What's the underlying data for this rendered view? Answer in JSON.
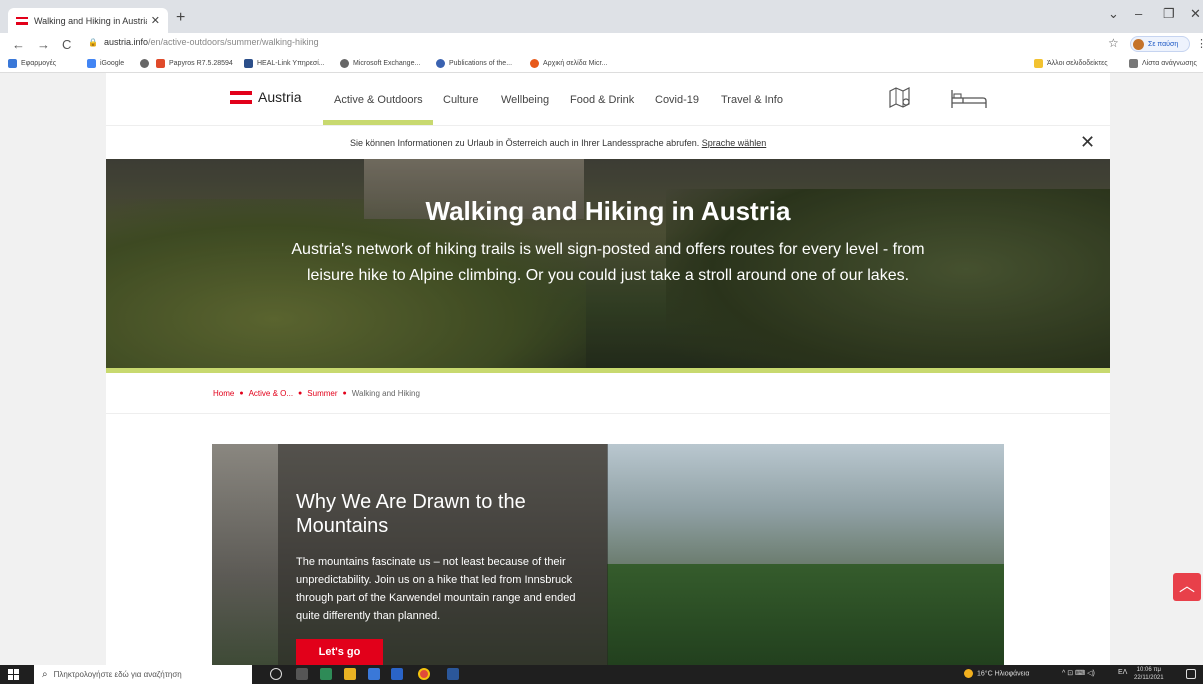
{
  "browser": {
    "tab_title": "Walking and Hiking in Austria -",
    "tab_close": "✕",
    "new_tab": "+",
    "url_host": "austria.info",
    "url_path": "/en/active-outdoors/summer/walking-hiking",
    "profile_label": "Σε παύση",
    "bookmarks": [
      "Εφαρμογές",
      "iGoogle",
      "",
      "Papyros R7.5.28594",
      "HEAL-Link Υπηρεσί...",
      "Microsoft Exchange...",
      "Publications of the...",
      "Αρχική σελίδα Micr..."
    ],
    "bookmarks_right": [
      "Άλλοι σελιδοδείκτες",
      "Λίστα ανάγνωσης"
    ]
  },
  "site": {
    "logo": "Austria",
    "nav": [
      "Active & Outdoors",
      "Culture",
      "Wellbeing",
      "Food & Drink",
      "Covid-19",
      "Travel & Info"
    ],
    "lang_notice": "Sie können Informationen zu Urlaub in Österreich auch in Ihrer Landessprache abrufen.",
    "lang_link": "Sprache wählen",
    "close": "✕"
  },
  "hero": {
    "title": "Walking and Hiking in Austria",
    "text": "Austria's network of hiking trails is well sign-posted and offers routes for every level - from leisure hike to Alpine climbing. Or you could just take a stroll around one of our lakes."
  },
  "breadcrumb": [
    "Home",
    "Active & O...",
    "Summer",
    "Walking and Hiking"
  ],
  "feature": {
    "title": "Why We Are Drawn to the Mountains",
    "text": "The mountains fascinate us – not least because of their unpredictability. Join us on a hike that led from Innsbruck through part of the Karwendel mountain range and ended quite differently than planned.",
    "cta": "Let's go"
  },
  "taskbar": {
    "search_placeholder": "Πληκτρολογήστε εδώ για αναζήτηση",
    "weather": "16°C Ηλιοφάνεια",
    "lang": "ΕΛ",
    "time": "10:06 πμ",
    "date": "22/11/2021"
  },
  "colors": {
    "brand_red": "#e2001a",
    "accent_green": "#c8d96f"
  }
}
